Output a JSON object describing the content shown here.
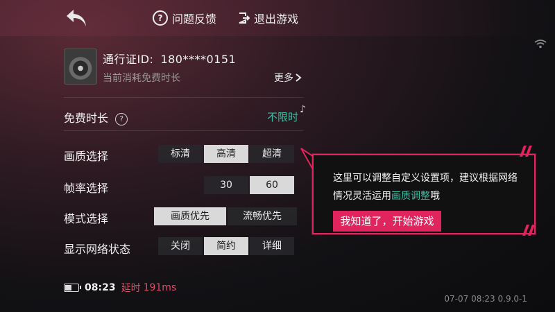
{
  "topbar": {
    "feedback_label": "问题反馈",
    "exit_label": "退出游戏"
  },
  "profile": {
    "pass_id_label": "通行证ID:",
    "pass_id_value": "180****0151",
    "subtitle": "当前消耗免费时长",
    "more_label": "更多"
  },
  "free_time": {
    "label": "免费时长",
    "value": "不限时"
  },
  "settings": {
    "quality": {
      "label": "画质选择",
      "options": [
        "标清",
        "高清",
        "超清"
      ],
      "selected": "高清"
    },
    "framerate": {
      "label": "帧率选择",
      "options": [
        "30",
        "60"
      ],
      "selected": "60"
    },
    "mode": {
      "label": "模式选择",
      "options": [
        "画质优先",
        "流畅优先"
      ],
      "selected": "画质优先"
    },
    "network": {
      "label": "显示网络状态",
      "options": [
        "关闭",
        "简约",
        "详细"
      ],
      "selected": "简约"
    }
  },
  "status": {
    "time": "08:23",
    "latency_label": "延时",
    "latency_value": "191ms"
  },
  "version": "07-07 08:23 0.9.0-1",
  "tooltip": {
    "line1": "这里可以调整自定义设置项，建议根据网络",
    "line2_prefix": "情况灵活运用",
    "line2_link": "画质调整",
    "line2_suffix": "哦",
    "button_label": "我知道了，开始游戏"
  },
  "colors": {
    "accent": "#e0245e",
    "teal": "#3dbfa5"
  }
}
